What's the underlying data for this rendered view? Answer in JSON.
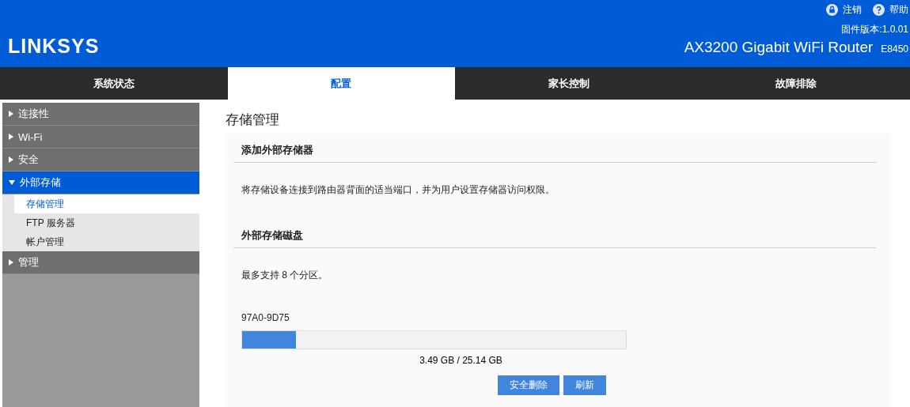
{
  "header": {
    "logo": "LINKSYS",
    "links": [
      {
        "kind": "lock",
        "label": "注销"
      },
      {
        "kind": "help",
        "label": "帮助"
      }
    ],
    "firmware": "固件版本:1.0.01",
    "product": "AX3200 Gigabit WiFi Router",
    "model": "E8450"
  },
  "tabs": [
    {
      "label": "系统状态",
      "selected": false
    },
    {
      "label": "配置",
      "selected": true
    },
    {
      "label": "家长控制",
      "selected": false
    },
    {
      "label": "故障排除",
      "selected": false
    }
  ],
  "sidebar": {
    "items": [
      {
        "label": "连接性",
        "expanded": false
      },
      {
        "label": "Wi-Fi",
        "expanded": false
      },
      {
        "label": "安全",
        "expanded": false
      },
      {
        "label": "外部存储",
        "expanded": true,
        "children": [
          {
            "label": "存储管理",
            "selected": true
          },
          {
            "label": "FTP 服务器",
            "selected": false
          },
          {
            "label": "帐户管理",
            "selected": false
          }
        ]
      },
      {
        "label": "管理",
        "expanded": false
      }
    ]
  },
  "page": {
    "title": "存储管理",
    "sections": [
      {
        "heading": "添加外部存储器",
        "text": "将存储设备连接到路由器背面的适当端口，并为用户设置存储器访问权限。"
      },
      {
        "heading": "外部存储磁盘",
        "text": "最多支持 8 个分区。"
      }
    ],
    "disk": {
      "name": "97A0-9D75",
      "level": 0.14,
      "usage": "3.49 GB / 25.14 GB"
    },
    "buttons": [
      "安全删除",
      "刷新"
    ]
  }
}
